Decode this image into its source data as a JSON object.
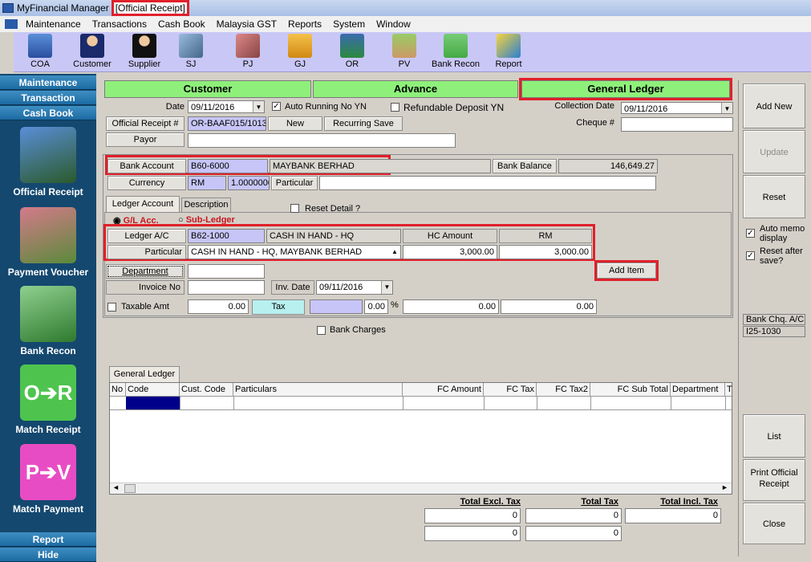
{
  "window": {
    "app_title": "MyFinancial Manager",
    "doc_title": "[Official Receipt]"
  },
  "menu": [
    "Maintenance",
    "Transactions",
    "Cash Book",
    "Malaysia GST",
    "Reports",
    "System",
    "Window"
  ],
  "toolbar": [
    "COA",
    "Customer",
    "Supplier",
    "SJ",
    "PJ",
    "GJ",
    "OR",
    "PV",
    "Bank Recon",
    "Report"
  ],
  "sidebar": {
    "headers": [
      "Maintenance",
      "Transaction",
      "Cash Book"
    ],
    "items": [
      "Official Receipt",
      "Payment Voucher",
      "Bank Recon",
      "Match Receipt",
      "Match Payment"
    ],
    "bottom": [
      "Report",
      "Hide"
    ]
  },
  "tabs": {
    "customer": "Customer",
    "advance": "Advance",
    "general_ledger": "General Ledger"
  },
  "header": {
    "date_label": "Date",
    "date_value": "09/11/2016",
    "auto_running_label": "Auto Running No YN",
    "refundable_label": "Refundable Deposit YN",
    "collection_date_label": "Collection Date",
    "collection_date_value": "09/11/2016",
    "cheque_label": "Cheque #",
    "cheque_value": "",
    "receipt_btn": "Official Receipt #",
    "receipt_value": "OR-BAAF015/1013",
    "new_btn": "New",
    "recurring_btn": "Recurring Save",
    "payor_btn": "Payor",
    "payor_value": "",
    "bank_account_btn": "Bank Account",
    "bank_code": "B60-6000",
    "bank_name": "MAYBANK BERHAD",
    "bank_balance_btn": "Bank Balance",
    "bank_balance_value": "146,649.27",
    "currency_btn": "Currency",
    "currency_code": "RM",
    "currency_rate": "1.000000000",
    "particular_btn": "Particular",
    "particular_value": ""
  },
  "ledger": {
    "tab_ledger": "Ledger Account",
    "tab_desc": "Description",
    "radio_gl": "G/L Acc.",
    "radio_sub": "Sub-Ledger",
    "reset_detail": "Reset Detail ?",
    "ledger_btn": "Ledger A/C",
    "ledger_code": "B62-1000",
    "ledger_name": "CASH IN HAND - HQ",
    "hc_amount_hdr": "HC Amount",
    "rm_hdr": "RM",
    "particular_btn": "Particular",
    "particular_value": "CASH IN HAND - HQ, MAYBANK BERHAD",
    "hc_amount": "3,000.00",
    "rm_amount": "3,000.00",
    "add_item": "Add Item",
    "department_btn": "Department",
    "department_value": "",
    "invoice_label": "Invoice No",
    "invoice_value": "",
    "inv_date_label": "Inv. Date",
    "inv_date_value": "09/11/2016",
    "taxable_label": "Taxable Amt",
    "taxable_value": "0.00",
    "tax_btn": "Tax",
    "tax_pct": "0.00",
    "pct_sign": "%",
    "tax_amt1": "0.00",
    "tax_amt2": "0.00",
    "bank_charges": "Bank Charges"
  },
  "right": {
    "add_new": "Add New",
    "update": "Update",
    "reset": "Reset",
    "auto_memo": "Auto memo display",
    "reset_after": "Reset after save?",
    "bank_chq_label": "Bank Chq. A/C :",
    "bank_chq_value": "I25-1030",
    "list": "List",
    "print": "Print Official Receipt",
    "close": "Close"
  },
  "grid": {
    "tab": "General Ledger",
    "columns": [
      "No",
      "Code",
      "Cust. Code",
      "Particulars",
      "FC Amount",
      "FC Tax",
      "FC Tax2",
      "FC Sub Total",
      "Department",
      "T"
    ]
  },
  "totals": {
    "excl_label": "Total Excl. Tax",
    "tax_label": "Total Tax",
    "incl_label": "Total Incl. Tax",
    "excl1": "0",
    "tax1": "0",
    "incl1": "0",
    "excl2": "0",
    "tax2": "0"
  },
  "colors": {
    "toolbar_bg": "#c9c7f5",
    "sidebar_bg": "#14486f",
    "tab_green": "#8ef07a",
    "highlight": "#e0202a"
  }
}
